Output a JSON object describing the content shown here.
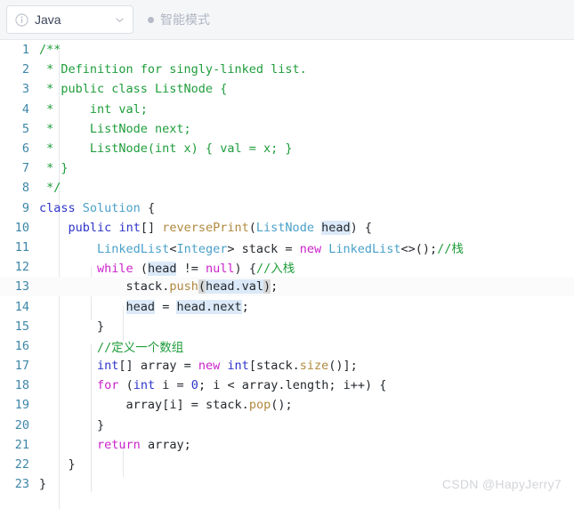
{
  "header": {
    "language_select": {
      "label": "Java",
      "icon": "info-circle-icon",
      "chevron": "chevron-down-icon"
    },
    "mode": {
      "label": "智能模式",
      "dot": "status-dot-icon"
    }
  },
  "editor": {
    "active_line": 13,
    "colors": {
      "comment": "#1f9d3b",
      "keyword_magenta": "#cc21cc",
      "keyword_blue": "#2e34c9",
      "type": "#4aa0c8",
      "method": "#b08a3e",
      "plain": "#24292e",
      "line_number": "#3d86a8",
      "occurrence_highlight": "#dbe9f8",
      "bracket_highlight": "#d8d8d8",
      "header_bg": "#f5f6f8",
      "editor_bg": "#ffffff"
    },
    "lines": [
      {
        "n": "1",
        "text": "/**"
      },
      {
        "n": "2",
        "text": " * Definition for singly-linked list."
      },
      {
        "n": "3",
        "text": " * public class ListNode {"
      },
      {
        "n": "4",
        "text": " *     int val;"
      },
      {
        "n": "5",
        "text": " *     ListNode next;"
      },
      {
        "n": "6",
        "text": " *     ListNode(int x) { val = x; }"
      },
      {
        "n": "7",
        "text": " * }"
      },
      {
        "n": "8",
        "text": " */"
      },
      {
        "n": "9",
        "text": "class Solution {"
      },
      {
        "n": "10",
        "text": "    public int[] reversePrint(ListNode head) {"
      },
      {
        "n": "11",
        "text": "        LinkedList<Integer> stack = new LinkedList<>();//栈"
      },
      {
        "n": "12",
        "text": "        while (head != null) {//入栈"
      },
      {
        "n": "13",
        "text": "            stack.push(head.val);"
      },
      {
        "n": "14",
        "text": "            head = head.next;"
      },
      {
        "n": "15",
        "text": "        }"
      },
      {
        "n": "16",
        "text": "        //定义一个数组"
      },
      {
        "n": "17",
        "text": "        int[] array = new int[stack.size()];"
      },
      {
        "n": "18",
        "text": "        for (int i = 0; i < array.length; i++) {"
      },
      {
        "n": "19",
        "text": "            array[i] = stack.pop();"
      },
      {
        "n": "20",
        "text": "        }"
      },
      {
        "n": "21",
        "text": "        return array;"
      },
      {
        "n": "22",
        "text": "    }"
      },
      {
        "n": "23",
        "text": "}"
      }
    ]
  },
  "watermark": {
    "text": "CSDN @HapyJerry7"
  }
}
